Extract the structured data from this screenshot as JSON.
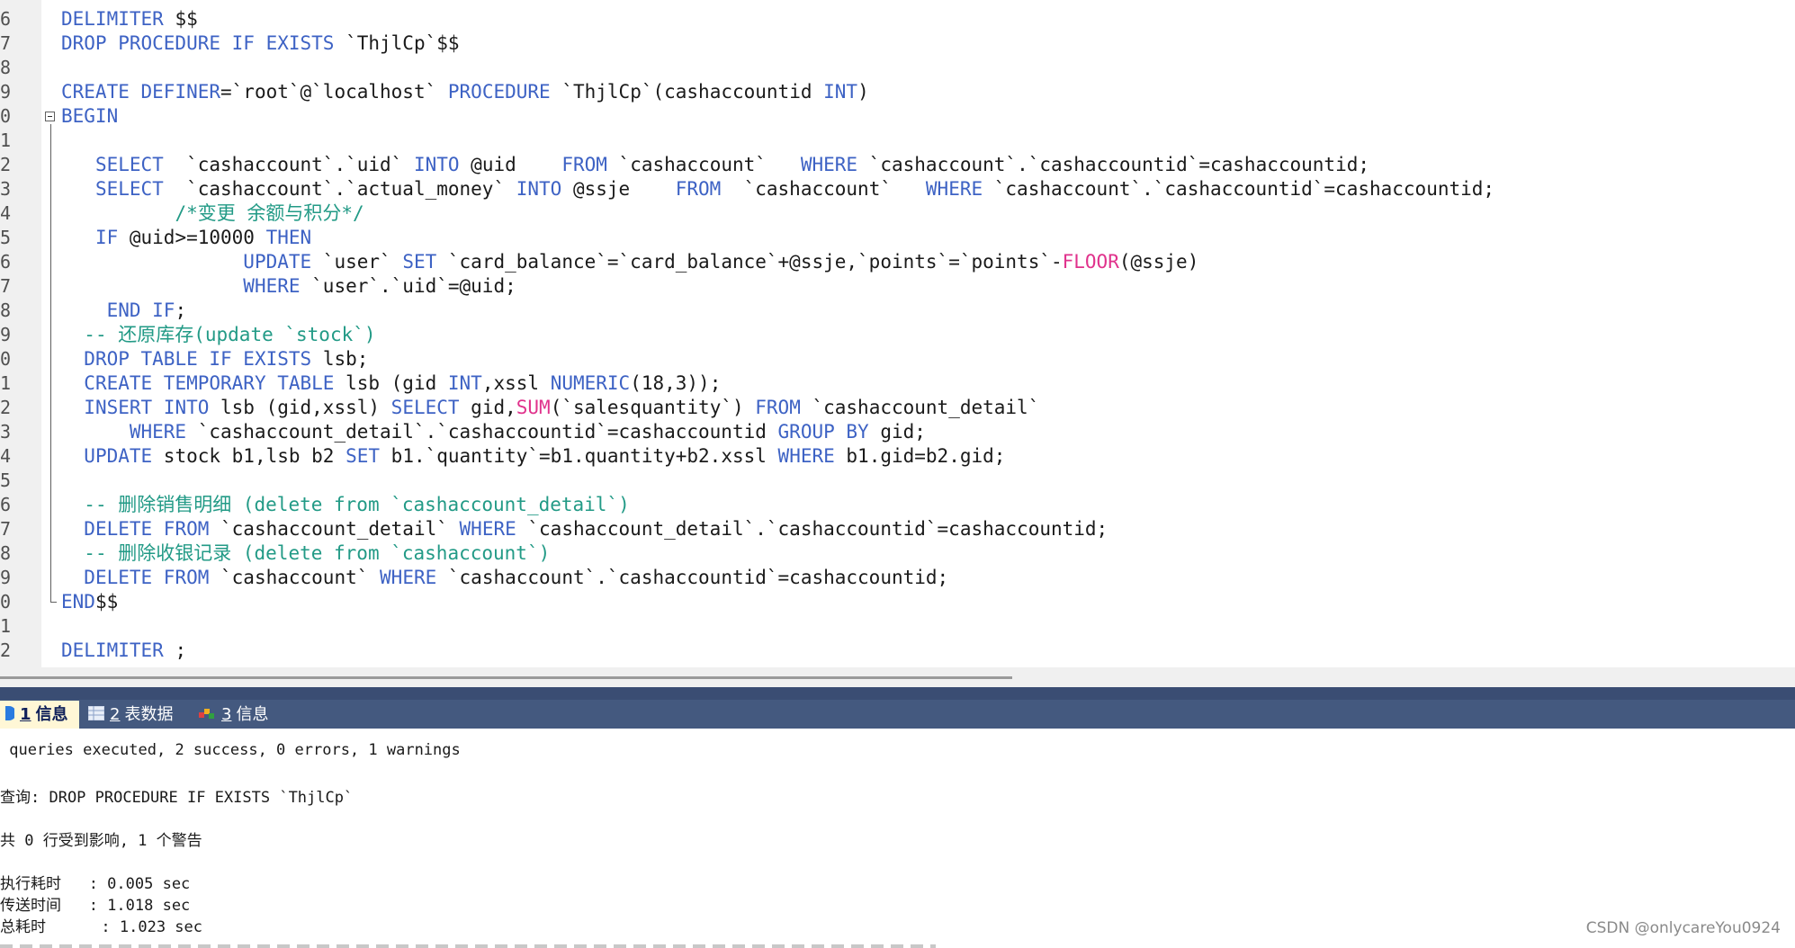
{
  "editor": {
    "lines": [
      {
        "n": "6",
        "html": "<span class=\"k\">DELIMITER</span> $$"
      },
      {
        "n": "7",
        "html": "<span class=\"k\">DROP PROCEDURE IF EXISTS</span> `ThjlCp`$$"
      },
      {
        "n": "8",
        "html": ""
      },
      {
        "n": "9",
        "html": "<span class=\"k\">CREATE DEFINER</span>=`root`@`localhost` <span class=\"k\">PROCEDURE</span> `ThjlCp`(cashaccountid <span class=\"k\">INT</span>)"
      },
      {
        "n": "0",
        "html": "<span class=\"k\">BEGIN</span>"
      },
      {
        "n": "1",
        "html": ""
      },
      {
        "n": "2",
        "html": "   <span class=\"k\">SELECT</span>  `cashaccount`.`uid` <span class=\"k\">INTO</span> @uid    <span class=\"k\">FROM</span> `cashaccount`   <span class=\"k\">WHERE</span> `cashaccount`.`cashaccountid`=cashaccountid;"
      },
      {
        "n": "3",
        "html": "   <span class=\"k\">SELECT</span>  `cashaccount`.`actual_money` <span class=\"k\">INTO</span> @ssje    <span class=\"k\">FROM</span>  `cashaccount`   <span class=\"k\">WHERE</span> `cashaccount`.`cashaccountid`=cashaccountid;"
      },
      {
        "n": "4",
        "html": "          <span class=\"c\">/*变更 余额与积分*/</span>"
      },
      {
        "n": "5",
        "html": "   <span class=\"k\">IF</span> @uid>=10000 <span class=\"k\">THEN</span>"
      },
      {
        "n": "6",
        "html": "                <span class=\"k\">UPDATE</span> `user` <span class=\"k\">SET</span> `card_balance`=`card_balance`+@ssje,`points`=`points`-<span class=\"f\">FLOOR</span>(@ssje)"
      },
      {
        "n": "7",
        "html": "                <span class=\"k\">WHERE</span> `user`.`uid`=@uid;"
      },
      {
        "n": "8",
        "html": "    <span class=\"k\">END IF</span>;"
      },
      {
        "n": "9",
        "html": "  <span class=\"c\">-- 还原库存(update `stock`)</span>"
      },
      {
        "n": "0",
        "html": "  <span class=\"k\">DROP TABLE IF EXISTS</span> lsb;"
      },
      {
        "n": "1",
        "html": "  <span class=\"k\">CREATE TEMPORARY TABLE</span> lsb (gid <span class=\"k\">INT</span>,xssl <span class=\"k\">NUMERIC</span>(18,3));"
      },
      {
        "n": "2",
        "html": "  <span class=\"k\">INSERT INTO</span> lsb (gid,xssl) <span class=\"k\">SELECT</span> gid,<span class=\"f\">SUM</span>(`salesquantity`) <span class=\"k\">FROM</span> `cashaccount_detail`"
      },
      {
        "n": "3",
        "html": "      <span class=\"k\">WHERE</span> `cashaccount_detail`.`cashaccountid`=cashaccountid <span class=\"k\">GROUP BY</span> gid;"
      },
      {
        "n": "4",
        "html": "  <span class=\"k\">UPDATE</span> stock b1,lsb b2 <span class=\"k\">SET</span> b1.`quantity`=b1.quantity+b2.xssl <span class=\"k\">WHERE</span> b1.gid=b2.gid;"
      },
      {
        "n": "5",
        "html": ""
      },
      {
        "n": "6",
        "html": "  <span class=\"c\">-- 删除销售明细 (delete from `cashaccount_detail`)</span>"
      },
      {
        "n": "7",
        "html": "  <span class=\"k\">DELETE FROM</span> `cashaccount_detail` <span class=\"k\">WHERE</span> `cashaccount_detail`.`cashaccountid`=cashaccountid;"
      },
      {
        "n": "8",
        "html": "  <span class=\"c\">-- 删除收银记录 (delete from `cashaccount`)</span>"
      },
      {
        "n": "9",
        "html": "  <span class=\"k\">DELETE FROM</span> `cashaccount` <span class=\"k\">WHERE</span> `cashaccount`.`cashaccountid`=cashaccountid;"
      },
      {
        "n": "0",
        "html": "<span class=\"k\">END</span>$$"
      },
      {
        "n": "1",
        "html": ""
      },
      {
        "n": "2",
        "html": "<span class=\"k\">DELIMITER</span> ;"
      }
    ]
  },
  "tabs": [
    {
      "num": "1",
      "label": "信息"
    },
    {
      "num": "2",
      "label": "表数据"
    },
    {
      "num": "3",
      "label": "信息"
    }
  ],
  "output": {
    "summary": " queries executed, 2 success, 0 errors, 1 warnings",
    "query": "查询: DROP PROCEDURE IF EXISTS `ThjlCp`",
    "affected": "共 0 行受到影响, 1 个警告",
    "exec_time": "执行耗时   : 0.005 sec",
    "transfer_time": "传送时间   : 1.018 sec",
    "total_time": "总耗时      : 1.023 sec"
  },
  "watermark": "CSDN @onlycareYou0924"
}
